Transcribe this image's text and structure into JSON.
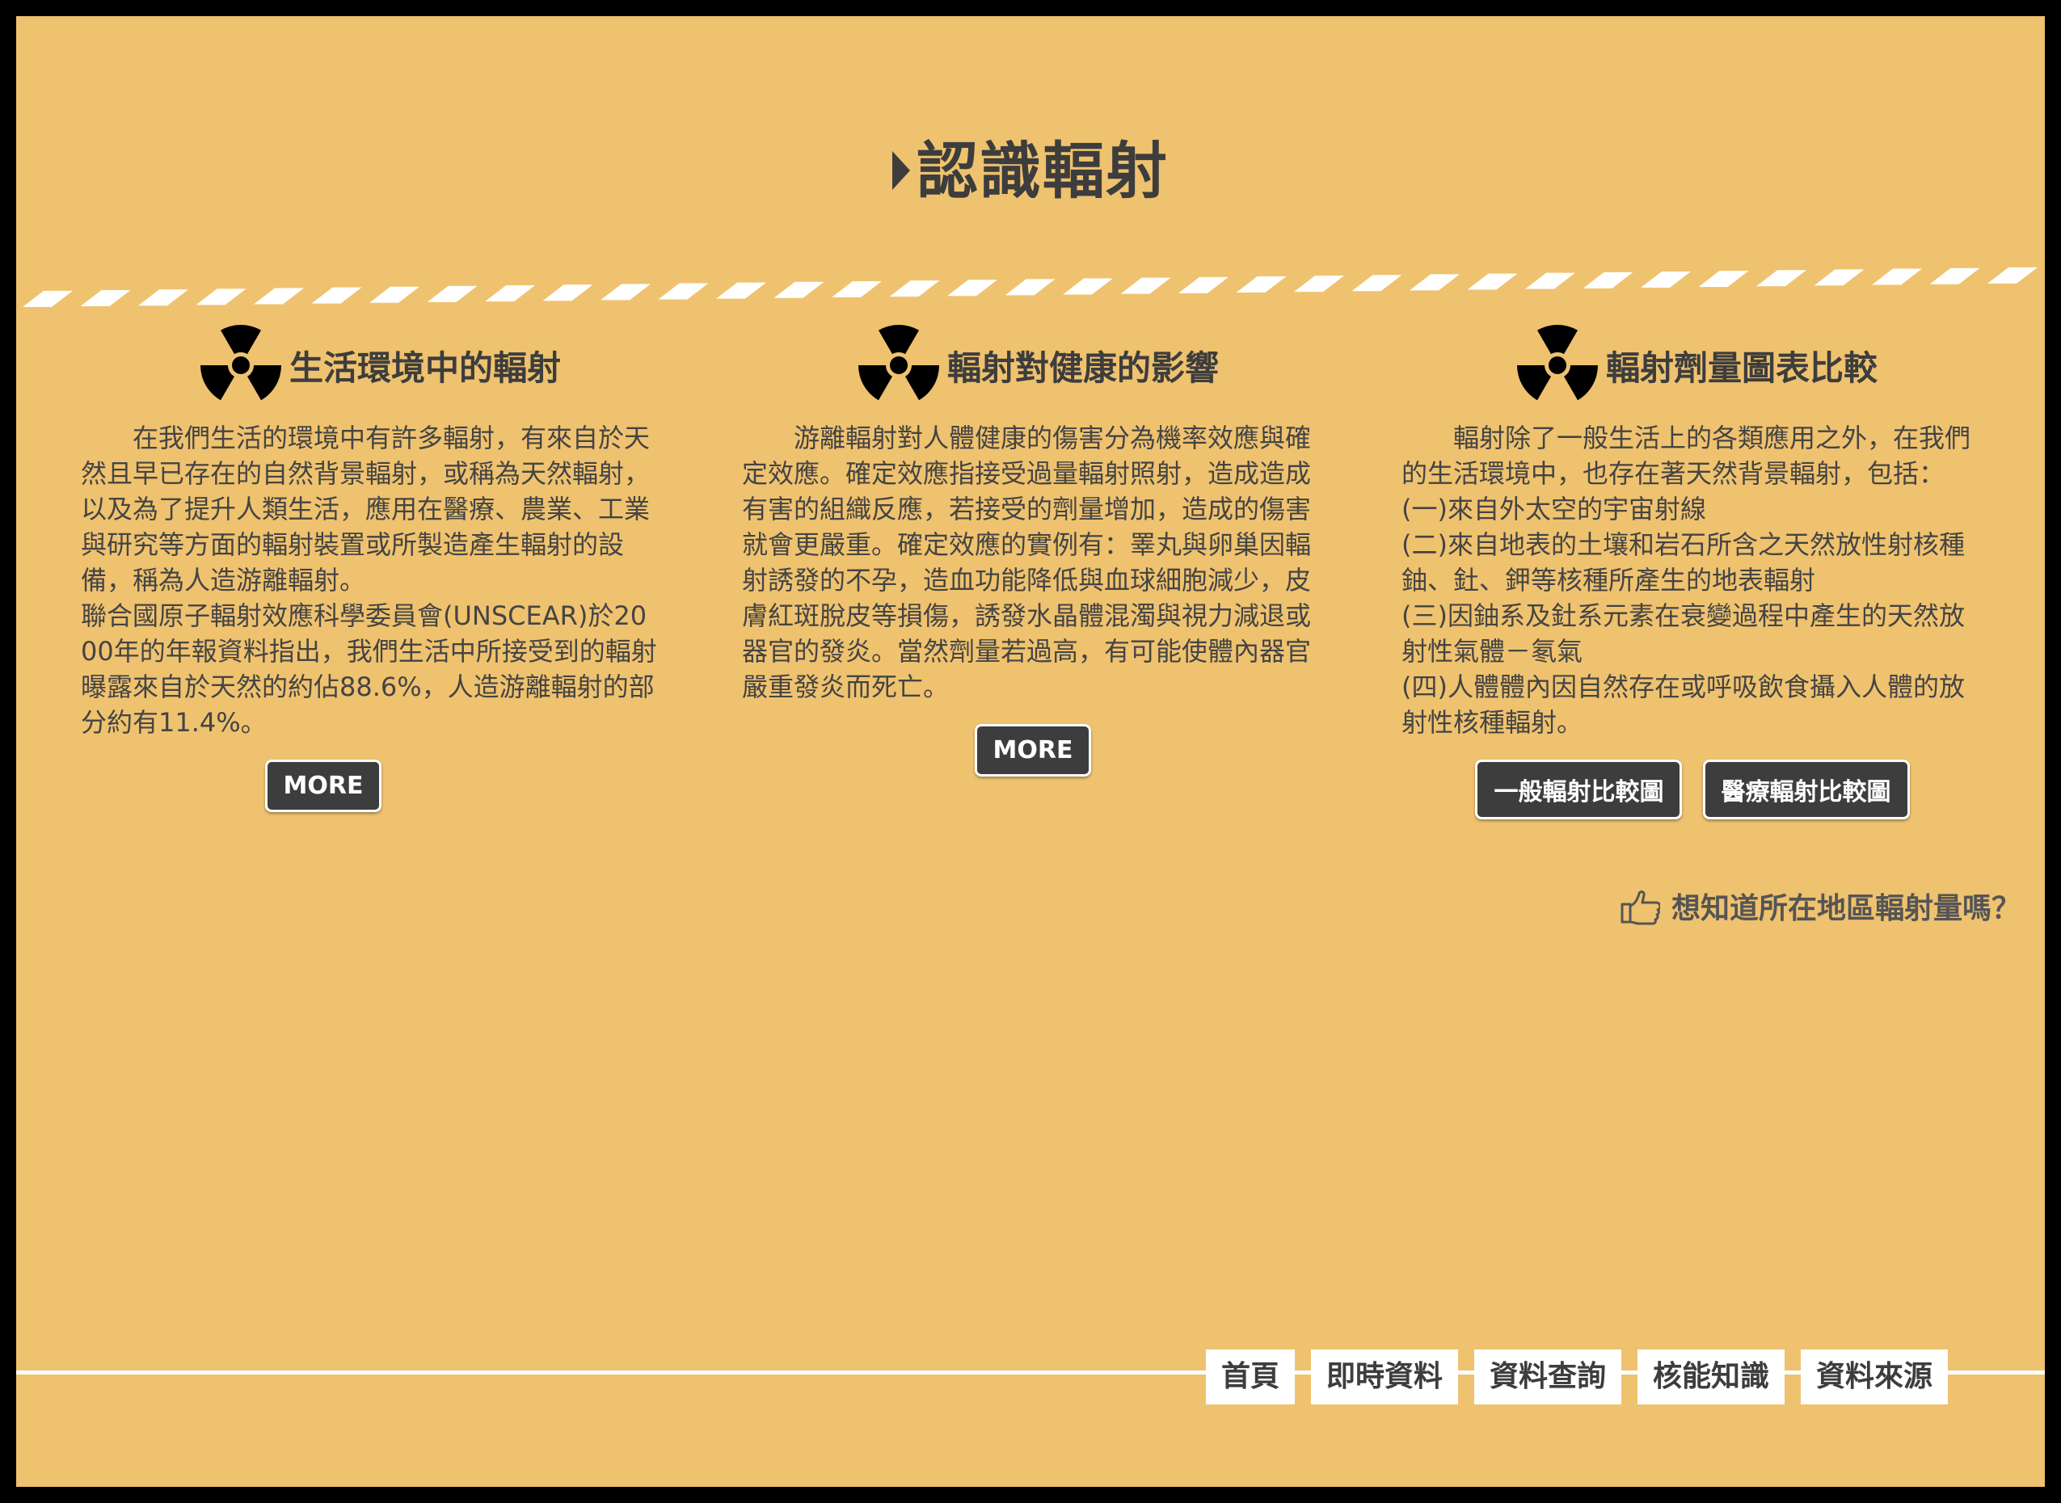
{
  "page": {
    "title": "認識輻射"
  },
  "sections": [
    {
      "title": "生活環境中的輻射",
      "icon": "radiation-icon",
      "paragraphs": [
        "在我們生活的環境中有許多輻射，有來自於天然且早已存在的自然背景輻射，或稱為天然輻射，以及為了提升人類生活，應用在醫療、農業、工業與研究等方面的輻射裝置或所製造產生輻射的設備，稱為人造游離輻射。",
        "聯合國原子輻射效應科學委員會(UNSCEAR)於2000年的年報資料指出，我們生活中所接受到的輻射曝露來自於天然的約佔88.6%，人造游離輻射的部分約有11.4%。"
      ],
      "buttons": [
        "MORE"
      ]
    },
    {
      "title": "輻射對健康的影響",
      "icon": "radiation-icon",
      "paragraphs": [
        "游離輻射對人體健康的傷害分為機率效應與確定效應。確定效應指接受過量輻射照射，造成造成有害的組織反應，若接受的劑量增加，造成的傷害就會更嚴重。確定效應的實例有：睪丸與卵巢因輻射誘發的不孕，造血功能降低與血球細胞減少，皮膚紅斑脫皮等損傷，誘發水晶體混濁與視力減退或器官的發炎。當然劑量若過高，有可能使體內器官嚴重發炎而死亡。"
      ],
      "buttons": [
        "MORE"
      ]
    },
    {
      "title": "輻射劑量圖表比較",
      "icon": "radiation-icon",
      "paragraphs": [
        "輻射除了一般生活上的各類應用之外，在我們的生活環境中，也存在著天然背景輻射，包括：",
        "(一)來自外太空的宇宙射線",
        "(二)來自地表的土壤和岩石所含之天然放性射核種鈾、釷、鉀等核種所產生的地表輻射",
        "(三)因鈾系及釷系元素在衰變過程中產生的天然放射性氣體－氡氣",
        "(四)人體體內因自然存在或呼吸飲食攝入人體的放射性核種輻射。"
      ],
      "buttons": [
        "一般輻射比較圖",
        "醫療輻射比較圖"
      ]
    }
  ],
  "region_link": {
    "label": "想知道所在地區輻射量嗎？",
    "icon": "pointing-hand-icon"
  },
  "footer_nav": [
    "首頁",
    "即時資料",
    "資料查詢",
    "核能知識",
    "資料來源"
  ],
  "colors": {
    "background": "#efc26f",
    "dark": "#3d3d3d",
    "text": "#444444",
    "white": "#ffffff"
  }
}
